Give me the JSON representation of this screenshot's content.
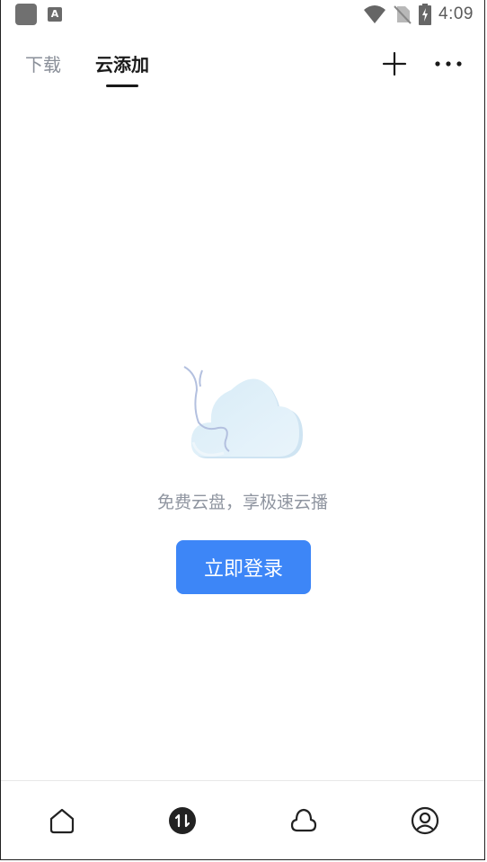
{
  "status_bar": {
    "time": "4:09",
    "notif_label": "A",
    "icons": [
      "app-notification-icon",
      "a-notification-icon",
      "wifi-icon",
      "no-sim-icon",
      "battery-charging-icon"
    ]
  },
  "header": {
    "tabs": [
      {
        "label": "下载",
        "selected": false
      },
      {
        "label": "云添加",
        "selected": true
      }
    ],
    "icons": [
      "plus-icon",
      "more-icon"
    ]
  },
  "empty_state": {
    "message": "免费云盘，享极速云播",
    "login_button": "立即登录",
    "illustration": "cloud-icon"
  },
  "bottom_nav": {
    "items": [
      {
        "icon": "home-icon",
        "selected": false
      },
      {
        "icon": "transfer-icon",
        "selected": true
      },
      {
        "icon": "cloud-icon",
        "selected": false
      },
      {
        "icon": "profile-icon",
        "selected": false
      }
    ]
  },
  "colors": {
    "accent": "#3d86f7",
    "text_primary": "#1a1a1a",
    "text_secondary": "#8a8f99"
  }
}
